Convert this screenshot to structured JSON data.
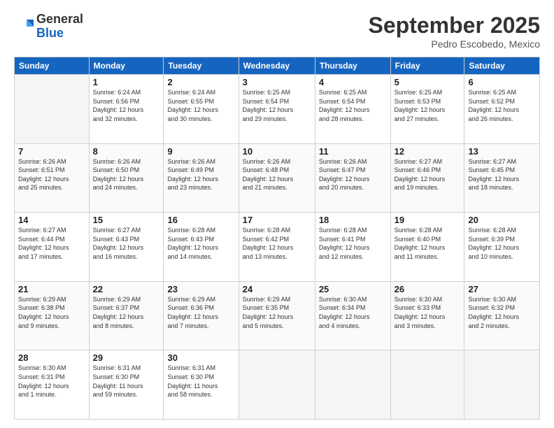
{
  "header": {
    "logo_general": "General",
    "logo_blue": "Blue",
    "month_title": "September 2025",
    "location": "Pedro Escobedo, Mexico"
  },
  "days_of_week": [
    "Sunday",
    "Monday",
    "Tuesday",
    "Wednesday",
    "Thursday",
    "Friday",
    "Saturday"
  ],
  "weeks": [
    [
      {
        "day": "",
        "info": ""
      },
      {
        "day": "1",
        "info": "Sunrise: 6:24 AM\nSunset: 6:56 PM\nDaylight: 12 hours\nand 32 minutes."
      },
      {
        "day": "2",
        "info": "Sunrise: 6:24 AM\nSunset: 6:55 PM\nDaylight: 12 hours\nand 30 minutes."
      },
      {
        "day": "3",
        "info": "Sunrise: 6:25 AM\nSunset: 6:54 PM\nDaylight: 12 hours\nand 29 minutes."
      },
      {
        "day": "4",
        "info": "Sunrise: 6:25 AM\nSunset: 6:54 PM\nDaylight: 12 hours\nand 28 minutes."
      },
      {
        "day": "5",
        "info": "Sunrise: 6:25 AM\nSunset: 6:53 PM\nDaylight: 12 hours\nand 27 minutes."
      },
      {
        "day": "6",
        "info": "Sunrise: 6:25 AM\nSunset: 6:52 PM\nDaylight: 12 hours\nand 26 minutes."
      }
    ],
    [
      {
        "day": "7",
        "info": "Sunrise: 6:26 AM\nSunset: 6:51 PM\nDaylight: 12 hours\nand 25 minutes."
      },
      {
        "day": "8",
        "info": "Sunrise: 6:26 AM\nSunset: 6:50 PM\nDaylight: 12 hours\nand 24 minutes."
      },
      {
        "day": "9",
        "info": "Sunrise: 6:26 AM\nSunset: 6:49 PM\nDaylight: 12 hours\nand 23 minutes."
      },
      {
        "day": "10",
        "info": "Sunrise: 6:26 AM\nSunset: 6:48 PM\nDaylight: 12 hours\nand 21 minutes."
      },
      {
        "day": "11",
        "info": "Sunrise: 6:26 AM\nSunset: 6:47 PM\nDaylight: 12 hours\nand 20 minutes."
      },
      {
        "day": "12",
        "info": "Sunrise: 6:27 AM\nSunset: 6:46 PM\nDaylight: 12 hours\nand 19 minutes."
      },
      {
        "day": "13",
        "info": "Sunrise: 6:27 AM\nSunset: 6:45 PM\nDaylight: 12 hours\nand 18 minutes."
      }
    ],
    [
      {
        "day": "14",
        "info": "Sunrise: 6:27 AM\nSunset: 6:44 PM\nDaylight: 12 hours\nand 17 minutes."
      },
      {
        "day": "15",
        "info": "Sunrise: 6:27 AM\nSunset: 6:43 PM\nDaylight: 12 hours\nand 16 minutes."
      },
      {
        "day": "16",
        "info": "Sunrise: 6:28 AM\nSunset: 6:43 PM\nDaylight: 12 hours\nand 14 minutes."
      },
      {
        "day": "17",
        "info": "Sunrise: 6:28 AM\nSunset: 6:42 PM\nDaylight: 12 hours\nand 13 minutes."
      },
      {
        "day": "18",
        "info": "Sunrise: 6:28 AM\nSunset: 6:41 PM\nDaylight: 12 hours\nand 12 minutes."
      },
      {
        "day": "19",
        "info": "Sunrise: 6:28 AM\nSunset: 6:40 PM\nDaylight: 12 hours\nand 11 minutes."
      },
      {
        "day": "20",
        "info": "Sunrise: 6:28 AM\nSunset: 6:39 PM\nDaylight: 12 hours\nand 10 minutes."
      }
    ],
    [
      {
        "day": "21",
        "info": "Sunrise: 6:29 AM\nSunset: 6:38 PM\nDaylight: 12 hours\nand 9 minutes."
      },
      {
        "day": "22",
        "info": "Sunrise: 6:29 AM\nSunset: 6:37 PM\nDaylight: 12 hours\nand 8 minutes."
      },
      {
        "day": "23",
        "info": "Sunrise: 6:29 AM\nSunset: 6:36 PM\nDaylight: 12 hours\nand 7 minutes."
      },
      {
        "day": "24",
        "info": "Sunrise: 6:29 AM\nSunset: 6:35 PM\nDaylight: 12 hours\nand 5 minutes."
      },
      {
        "day": "25",
        "info": "Sunrise: 6:30 AM\nSunset: 6:34 PM\nDaylight: 12 hours\nand 4 minutes."
      },
      {
        "day": "26",
        "info": "Sunrise: 6:30 AM\nSunset: 6:33 PM\nDaylight: 12 hours\nand 3 minutes."
      },
      {
        "day": "27",
        "info": "Sunrise: 6:30 AM\nSunset: 6:32 PM\nDaylight: 12 hours\nand 2 minutes."
      }
    ],
    [
      {
        "day": "28",
        "info": "Sunrise: 6:30 AM\nSunset: 6:31 PM\nDaylight: 12 hours\nand 1 minute."
      },
      {
        "day": "29",
        "info": "Sunrise: 6:31 AM\nSunset: 6:30 PM\nDaylight: 11 hours\nand 59 minutes."
      },
      {
        "day": "30",
        "info": "Sunrise: 6:31 AM\nSunset: 6:30 PM\nDaylight: 11 hours\nand 58 minutes."
      },
      {
        "day": "",
        "info": ""
      },
      {
        "day": "",
        "info": ""
      },
      {
        "day": "",
        "info": ""
      },
      {
        "day": "",
        "info": ""
      }
    ]
  ]
}
